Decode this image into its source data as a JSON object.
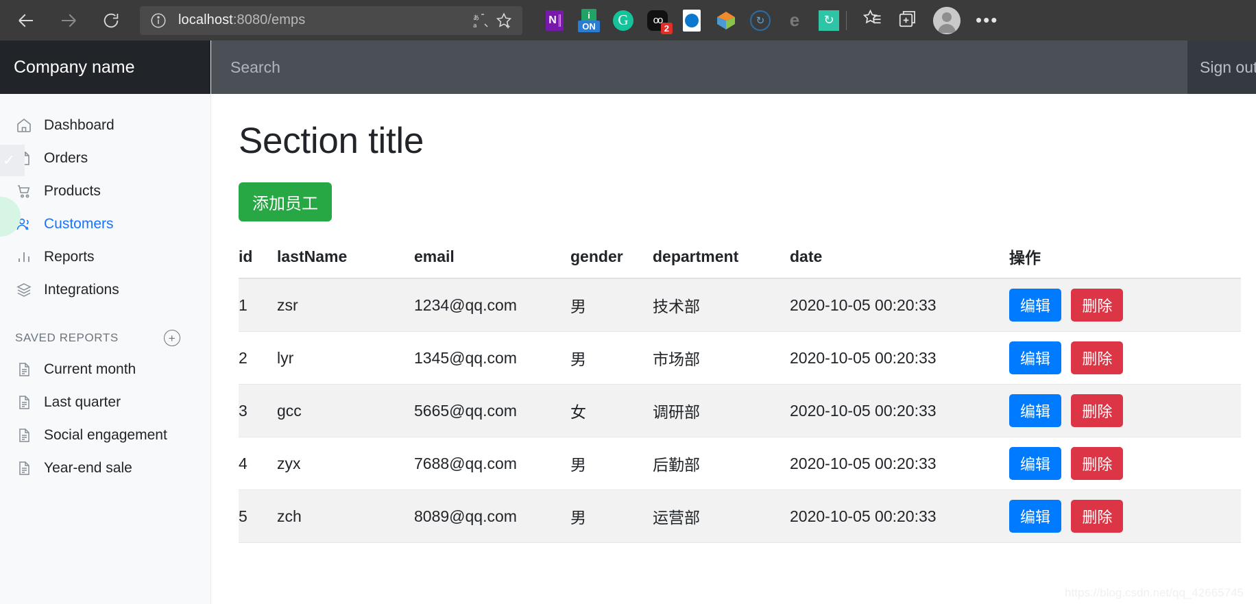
{
  "browser": {
    "back_label": "back-arrow",
    "forward_label": "forward-arrow",
    "reload_label": "reload",
    "url_main": "localhost",
    "url_rest": ":8080/emps",
    "translate_icon": "translate-icon",
    "favorite_icon": "star-add-icon",
    "extensions": [
      {
        "name": "onenote",
        "label": "N"
      },
      {
        "name": "onenote-on",
        "top": "i",
        "bottom": "ON"
      },
      {
        "name": "grammarly",
        "label": "G"
      },
      {
        "name": "oo-extension",
        "label": "oo",
        "badge": "2"
      },
      {
        "name": "cloud-extension",
        "label": ""
      },
      {
        "name": "box-extension",
        "label": ""
      },
      {
        "name": "sync-extension",
        "label": "↻"
      },
      {
        "name": "edge-extension",
        "label": "e"
      },
      {
        "name": "teal-sync-extension",
        "label": "↻"
      }
    ],
    "collections_icon": "collections-icon",
    "favorites_icon": "favorites-list-icon",
    "profile_icon": "profile-avatar",
    "more_icon": "•••"
  },
  "sidebar": {
    "brand": "Company name",
    "items": [
      {
        "label": "Dashboard",
        "icon": "home-icon",
        "active": false
      },
      {
        "label": "Orders",
        "icon": "file-icon",
        "active": false
      },
      {
        "label": "Products",
        "icon": "cart-icon",
        "active": false
      },
      {
        "label": "Customers",
        "icon": "users-icon",
        "active": true
      },
      {
        "label": "Reports",
        "icon": "bar-chart-icon",
        "active": false
      },
      {
        "label": "Integrations",
        "icon": "layers-icon",
        "active": false
      }
    ],
    "saved_reports_heading": "SAVED REPORTS",
    "saved_reports_add": "+",
    "saved_reports": [
      {
        "label": "Current month",
        "icon": "document-icon"
      },
      {
        "label": "Last quarter",
        "icon": "document-icon"
      },
      {
        "label": "Social engagement",
        "icon": "document-icon"
      },
      {
        "label": "Year-end sale",
        "icon": "document-icon"
      }
    ]
  },
  "topbar": {
    "search_placeholder": "Search",
    "search_value": "",
    "signout_label": "Sign out"
  },
  "main": {
    "title": "Section title",
    "add_button": "添加员工",
    "table": {
      "columns": [
        "id",
        "lastName",
        "email",
        "gender",
        "department",
        "date",
        "操作"
      ],
      "rows": [
        {
          "id": "1",
          "lastName": "zsr",
          "email": "1234@qq.com",
          "gender": "男",
          "department": "技术部",
          "date": "2020-10-05 00:20:33"
        },
        {
          "id": "2",
          "lastName": "lyr",
          "email": "1345@qq.com",
          "gender": "男",
          "department": "市场部",
          "date": "2020-10-05 00:20:33"
        },
        {
          "id": "3",
          "lastName": "gcc",
          "email": "5665@qq.com",
          "gender": "女",
          "department": "调研部",
          "date": "2020-10-05 00:20:33"
        },
        {
          "id": "4",
          "lastName": "zyx",
          "email": "7688@qq.com",
          "gender": "男",
          "department": "后勤部",
          "date": "2020-10-05 00:20:33"
        },
        {
          "id": "5",
          "lastName": "zch",
          "email": "8089@qq.com",
          "gender": "男",
          "department": "运营部",
          "date": "2020-10-05 00:20:33"
        }
      ],
      "edit_label": "编辑",
      "delete_label": "删除"
    }
  },
  "watermark": "https://blog.csdn.net/qq_42665745",
  "colors": {
    "brand_dark": "#212529",
    "topbar": "#4a5056",
    "sidebar_bg": "#f8f9fa",
    "accent_blue": "#1a73ff",
    "btn_green": "#28a745",
    "btn_blue": "#007bff",
    "btn_red": "#dc3545",
    "browser_chrome": "#3b3b3b"
  }
}
